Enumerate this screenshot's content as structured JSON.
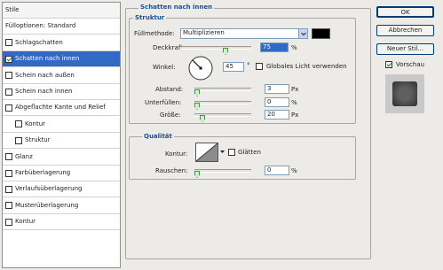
{
  "left_panel": {
    "items": [
      {
        "label": "Stile",
        "checkbox": false,
        "checked": false,
        "selected": false,
        "indent": 0
      },
      {
        "label": "Fülloptionen: Standard",
        "checkbox": false,
        "checked": false,
        "selected": false,
        "indent": 0
      },
      {
        "label": "Schlagschatten",
        "checkbox": true,
        "checked": false,
        "selected": false,
        "indent": 0
      },
      {
        "label": "Schatten nach innen",
        "checkbox": true,
        "checked": true,
        "selected": true,
        "indent": 0
      },
      {
        "label": "Schein nach außen",
        "checkbox": true,
        "checked": false,
        "selected": false,
        "indent": 0
      },
      {
        "label": "Schein nach innen",
        "checkbox": true,
        "checked": false,
        "selected": false,
        "indent": 0
      },
      {
        "label": "Abgeflachte Kante und Relief",
        "checkbox": true,
        "checked": false,
        "selected": false,
        "indent": 0
      },
      {
        "label": "Kontur",
        "checkbox": true,
        "checked": false,
        "selected": false,
        "indent": 1
      },
      {
        "label": "Struktur",
        "checkbox": true,
        "checked": false,
        "selected": false,
        "indent": 1
      },
      {
        "label": "Glanz",
        "checkbox": true,
        "checked": false,
        "selected": false,
        "indent": 0
      },
      {
        "label": "Farbüberlagerung",
        "checkbox": true,
        "checked": false,
        "selected": false,
        "indent": 0
      },
      {
        "label": "Verlaufsüberlagerung",
        "checkbox": true,
        "checked": false,
        "selected": false,
        "indent": 0
      },
      {
        "label": "Musterüberlagerung",
        "checkbox": true,
        "checked": false,
        "selected": false,
        "indent": 0
      },
      {
        "label": "Kontur",
        "checkbox": true,
        "checked": false,
        "selected": false,
        "indent": 0
      }
    ]
  },
  "panel": {
    "title": "Schatten nach innen",
    "struktur": {
      "title": "Struktur",
      "blend_label": "Füllmethode:",
      "blend_value": "Multiplizieren",
      "shadow_color": "#000000",
      "opacity_label": "Deckkraft:",
      "opacity_value": "75",
      "opacity_fraction": 0.75,
      "percent": "%",
      "angle_label": "Winkel:",
      "angle_value": "45",
      "degree": "°",
      "global_light_label": "Globales Licht verwenden",
      "distance_label": "Abstand:",
      "distance_value": "3",
      "distance_fraction": 0.12,
      "choke_label": "Unterfüllen:",
      "choke_value": "0",
      "choke_fraction": 0.0,
      "size_label": "Größe:",
      "size_value": "20",
      "size_fraction": 0.08,
      "px": "Px"
    },
    "qualitaet": {
      "title": "Qualität",
      "contour_label": "Kontur:",
      "antialias_label": "Glätten",
      "noise_label": "Rauschen:",
      "noise_value": "0",
      "noise_fraction": 0.0,
      "percent": "%"
    }
  },
  "right": {
    "ok": "OK",
    "cancel": "Abbrechen",
    "new_style": "Neuer Stil...",
    "preview_label": "Vorschau",
    "preview_checked": true
  }
}
